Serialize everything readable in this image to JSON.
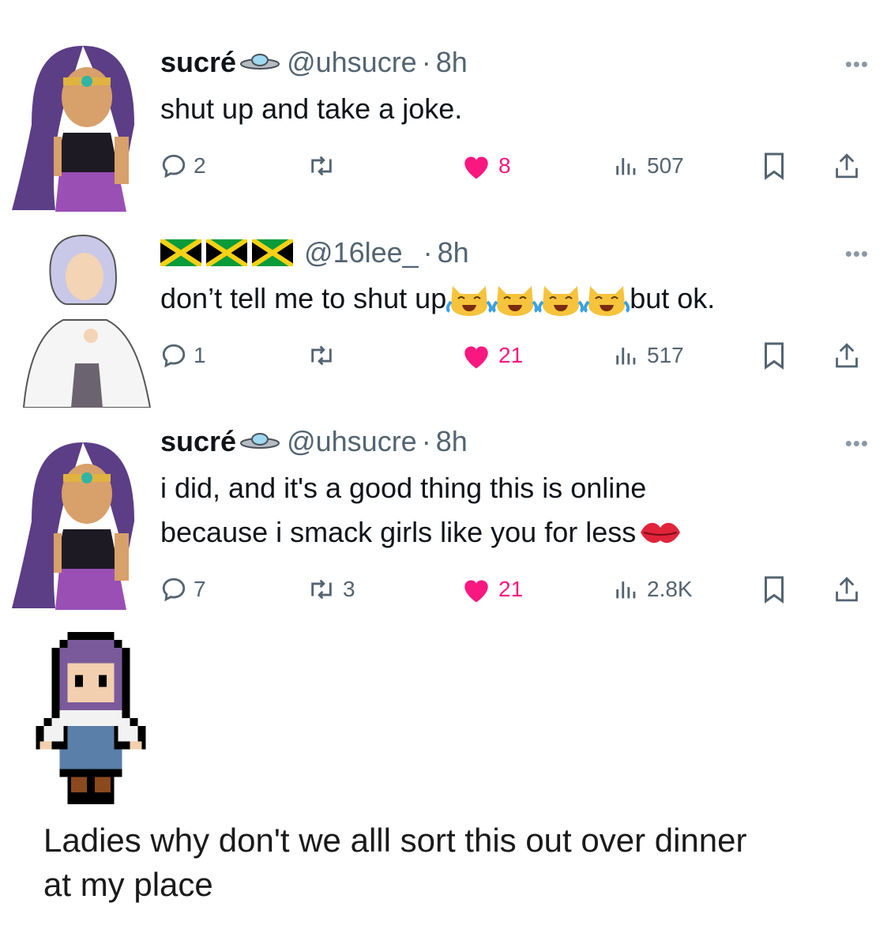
{
  "tweets": [
    {
      "name": "sucré",
      "name_icon": "ufo-icon",
      "handle": "@uhsucre",
      "dot": "·",
      "time": "8h",
      "lines": [
        "shut up and take a joke."
      ],
      "replies": "2",
      "retweets": "",
      "likes": "8",
      "views": "507",
      "more": "•••"
    },
    {
      "name_flags": [
        "jamaica-flag-icon",
        "jamaica-flag-icon",
        "jamaica-flag-icon"
      ],
      "handle": "@16lee_",
      "dot": "·",
      "time": "8h",
      "line_prefix": "don’t tell me to shut up",
      "line_emoji": [
        "crying-laughing-cat-icon",
        "crying-laughing-cat-icon",
        "crying-laughing-cat-icon",
        "crying-laughing-cat-icon"
      ],
      "line_suffix": "but ok.",
      "replies": "1",
      "retweets": "",
      "likes": "21",
      "views": "517",
      "more": "•••"
    },
    {
      "name": "sucré",
      "name_icon": "ufo-icon",
      "handle": "@uhsucre",
      "dot": "·",
      "time": "8h",
      "line1": "i did, and it's a good thing this is online",
      "line2": "because i smack girls like you for less",
      "line2_emoji": "kiss-mark-icon",
      "replies": "7",
      "retweets": "3",
      "likes": "21",
      "views": "2.8K",
      "more": "•••"
    }
  ],
  "caption": {
    "line1": "Ladies why don't we alll sort this out over dinner",
    "line2": "at my place"
  },
  "colors": {
    "like": "#f91880",
    "text": "#0f1419",
    "muted": "#536471"
  }
}
